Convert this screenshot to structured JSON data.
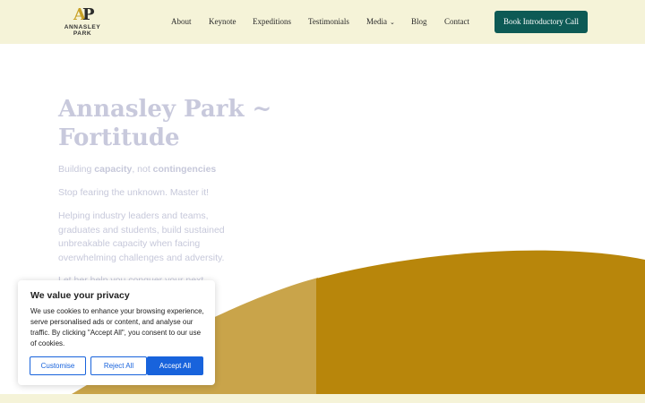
{
  "brand": {
    "logo_initial_a": "A",
    "logo_initial_p": "P",
    "logo_line1": "ANNASLEY",
    "logo_line2": "PARK"
  },
  "nav": {
    "items": [
      {
        "label": "About"
      },
      {
        "label": "Keynote"
      },
      {
        "label": "Expeditions"
      },
      {
        "label": "Testimonials"
      },
      {
        "label": "Media",
        "has_dropdown": true
      },
      {
        "label": "Blog"
      },
      {
        "label": "Contact"
      }
    ],
    "cta_label": "Book Introductory Call"
  },
  "hero": {
    "title_line1": "Annasley Park ~",
    "title_line2": "Fortitude",
    "tagline_pre": "Building ",
    "tagline_b1": "capacity",
    "tagline_mid": ", not ",
    "tagline_b2": "contingencies",
    "line2": "Stop fearing the unknown. Master it!",
    "paragraph": "Helping industry leaders and teams, graduates and students, build sustained unbreakable capacity when facing overwhelming challenges and adversity.",
    "paragraph_partial": "Let her help you conquer your next"
  },
  "cookie_banner": {
    "title": "We value your privacy",
    "text": "We use cookies to enhance your browsing experience, serve personalised ads or content, and analyse our traffic. By clicking \"Accept All\", you consent to our use of cookies.",
    "customise_label": "Customise",
    "reject_label": "Reject All",
    "accept_label": "Accept All"
  },
  "colors": {
    "header_bg": "#f5f3d8",
    "cta_bg": "#0d5a55",
    "gold_dark": "#b8860b",
    "gold_light": "#c9a44a",
    "hero_text": "#c8c9dc",
    "cookie_accent": "#1863dc"
  }
}
